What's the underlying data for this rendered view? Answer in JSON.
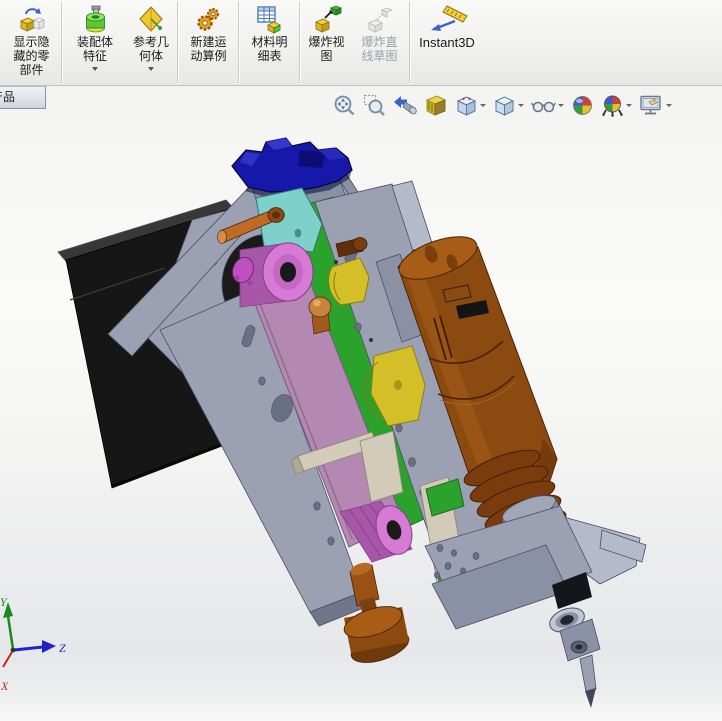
{
  "ribbon": {
    "buttons": [
      {
        "id": "show-hidden-components",
        "label": "显示隐\n藏的零\n部件",
        "icon": "show-hidden-components-icon",
        "disabled": false,
        "dropdown": false
      },
      {
        "id": "assembly-features",
        "label": "装配体\n特征",
        "icon": "assembly-features-icon",
        "disabled": false,
        "dropdown": true
      },
      {
        "id": "reference-geometry",
        "label": "参考几\n何体",
        "icon": "reference-geometry-icon",
        "disabled": false,
        "dropdown": true
      },
      {
        "id": "new-motion-study",
        "label": "新建运\n动算例",
        "icon": "motion-study-icon",
        "disabled": false,
        "dropdown": false
      },
      {
        "id": "bill-of-materials",
        "label": "材料明\n细表",
        "icon": "bom-icon",
        "disabled": false,
        "dropdown": false
      },
      {
        "id": "exploded-view",
        "label": "爆炸视\n图",
        "icon": "exploded-view-icon",
        "disabled": false,
        "dropdown": false
      },
      {
        "id": "explode-line-sketch",
        "label": "爆炸直\n线草图",
        "icon": "explode-line-sketch-icon",
        "disabled": true,
        "dropdown": false
      },
      {
        "id": "instant3d",
        "label": "Instant3D",
        "icon": "instant3d-icon",
        "disabled": false,
        "dropdown": false
      }
    ]
  },
  "doc_tab": {
    "label": "产品"
  },
  "hud": {
    "items": [
      {
        "id": "zoom-to-fit",
        "icon": "zoom-to-fit-icon",
        "dropdown": false
      },
      {
        "id": "zoom-to-area",
        "icon": "zoom-to-area-icon",
        "dropdown": false
      },
      {
        "id": "previous-view",
        "icon": "previous-view-icon",
        "dropdown": false
      },
      {
        "id": "section-view",
        "icon": "section-view-icon",
        "dropdown": false
      },
      {
        "id": "view-orientation",
        "icon": "view-orientation-icon",
        "dropdown": true
      },
      {
        "id": "display-style",
        "icon": "display-style-icon",
        "dropdown": true
      },
      {
        "id": "hide-show-items",
        "icon": "hide-show-items-icon",
        "dropdown": true
      },
      {
        "id": "edit-appearance",
        "icon": "edit-appearance-icon",
        "dropdown": false
      },
      {
        "id": "apply-scene",
        "icon": "apply-scene-icon",
        "dropdown": true
      },
      {
        "id": "view-settings",
        "icon": "view-settings-icon",
        "dropdown": true
      }
    ]
  },
  "triad": {
    "x_label": "X",
    "y_label": "Y",
    "z_label": "Z"
  },
  "colors": {
    "stroke_c": "#4a4f60",
    "frame": "#9ba1b3",
    "frame_light": "#b4bac9",
    "frame_mid": "#8b91a4",
    "frame_dark": "#70768a",
    "hole": "#6a7083",
    "motor": "#161616",
    "motor_top": "#383838",
    "servo": "#1518a8",
    "servo_dark": "#07083c",
    "cyan": "#7ed0ca",
    "green": "#2ba22b",
    "green_dark": "#176617",
    "belt": "#b389b3",
    "pulley": "#d67ad6",
    "pulley_dark": "#a857a8",
    "magenta": "#c050c0",
    "brown": "#8a4a10",
    "brown_light": "#a85c16",
    "brown_dark": "#4a2406",
    "copper": "#c8823c",
    "yellow": "#d4bf28",
    "yellow_dark": "#8a7a10",
    "tan": "#d2cbb8",
    "tan_dark": "#b0a992",
    "dark": "#1a1a1a",
    "axis_x": "#cc2222",
    "axis_y": "#1a8a1a",
    "axis_z": "#2222cc"
  }
}
